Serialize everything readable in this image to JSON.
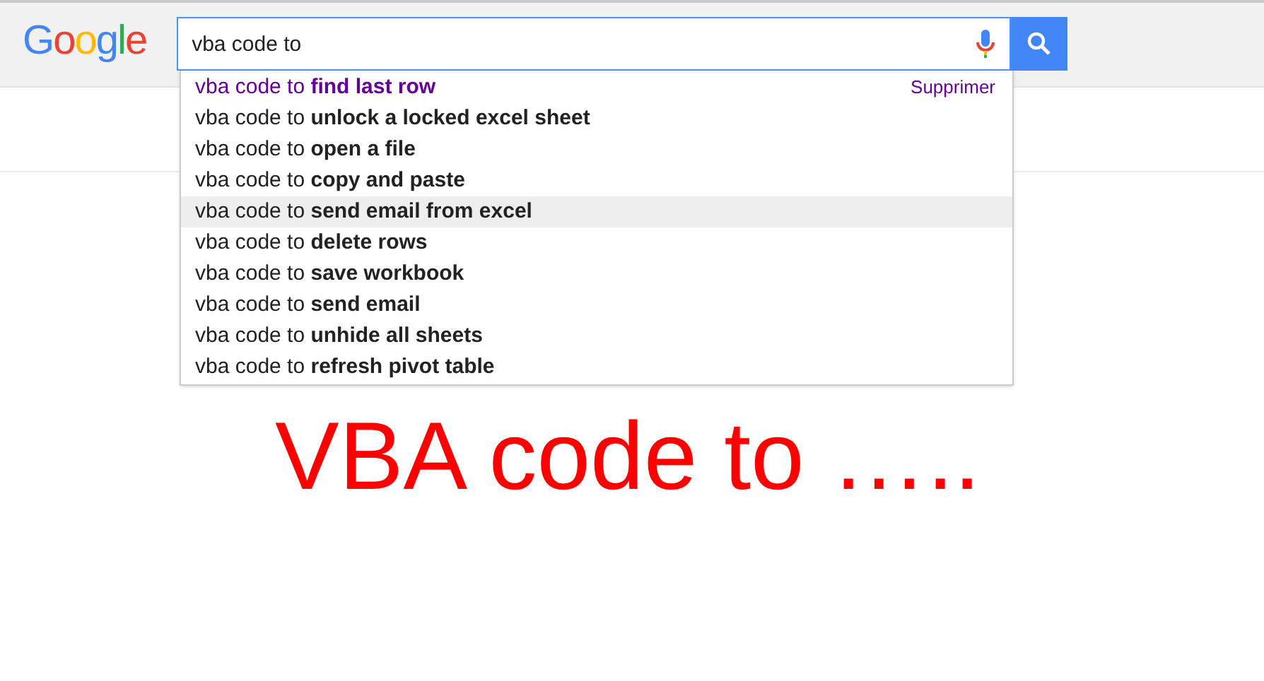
{
  "logo": "Google",
  "search": {
    "value": "vba code to"
  },
  "suggestions": [
    {
      "text": "vba code to **find last row**",
      "visited": true,
      "selected": false,
      "remove_link": "Supprimer"
    },
    {
      "text": "vba code to **unlock a locked excel sheet**",
      "visited": false,
      "selected": false
    },
    {
      "text": "vba code to **open a file**",
      "visited": false,
      "selected": false
    },
    {
      "text": "vba code to **copy and paste**",
      "visited": false,
      "selected": false
    },
    {
      "text": "vba code to **send email from excel**",
      "visited": false,
      "selected": true
    },
    {
      "text": "vba code to **delete rows**",
      "visited": false,
      "selected": false
    },
    {
      "text": "vba code to **save workbook**",
      "visited": false,
      "selected": false
    },
    {
      "text": "vba code to **send email**",
      "visited": false,
      "selected": false
    },
    {
      "text": "vba code to **unhide all sheets**",
      "visited": false,
      "selected": false
    },
    {
      "text": "vba code to **refresh pivot table**",
      "visited": false,
      "selected": false
    }
  ],
  "caption": "VBA code to ….."
}
